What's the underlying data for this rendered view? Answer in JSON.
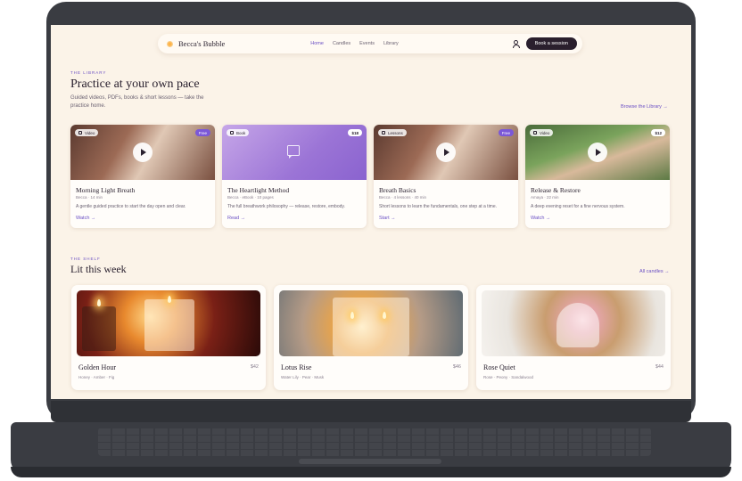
{
  "nav": {
    "brand": "Becca's Bubble",
    "links": [
      "Home",
      "Candles",
      "Events",
      "Library"
    ],
    "cta": "Book a session"
  },
  "library": {
    "eyebrow": "THE LIBRARY",
    "title": "Practice at your own pace",
    "subtitle": "Guided videos, PDFs, books & short lessons — take the practice home.",
    "browse": "Browse the Library →",
    "cards": [
      {
        "tag": "Video",
        "badge": "Free",
        "title": "Morning Light Breath",
        "meta": "Becca · 14 min",
        "desc": "A gentle guided practice to start the day open and clear.",
        "link": "Watch →"
      },
      {
        "tag": "Book",
        "badge": "$18",
        "title": "The Heartlight Method",
        "meta": "Becca · eBook · 10 pages",
        "desc": "The full breathwork philosophy — release, restore, embody.",
        "link": "Read →"
      },
      {
        "tag": "Lessons",
        "badge": "Free",
        "title": "Breath Basics",
        "meta": "Becca · 4 lessons · 40 min",
        "desc": "Short lessons to learn the fundamentals, one step at a time.",
        "link": "Start →"
      },
      {
        "tag": "Video",
        "badge": "$12",
        "title": "Release & Restore",
        "meta": "Amaya · 22 min",
        "desc": "A deep evening reset for a fine nervous system.",
        "link": "Watch →"
      }
    ]
  },
  "shelf": {
    "eyebrow": "THE SHELF",
    "title": "Lit this week",
    "all": "All candles →",
    "candles": [
      {
        "name": "Golden Hour",
        "price": "$42",
        "notes": "Honey · Amber · Fig"
      },
      {
        "name": "Lotus Rise",
        "price": "$46",
        "notes": "Water Lily · Pear · Musk"
      },
      {
        "name": "Rose Quiet",
        "price": "$44",
        "notes": "Rose · Peony · Sandalwood"
      }
    ]
  },
  "colors": {
    "accent": "#6a4fc4",
    "cta_bg": "#2a1f2d",
    "page_bg": "#fbf3e8"
  }
}
